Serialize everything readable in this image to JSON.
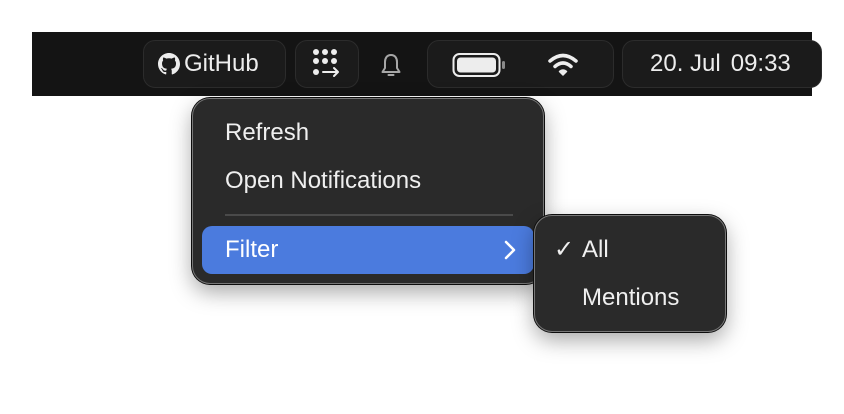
{
  "menubar": {
    "github_label": "GitHub",
    "github_icon": "github-icon",
    "apps_icon": "grid-arrow-icon",
    "bell_icon": "bell-icon",
    "battery_icon": "battery-icon",
    "wifi_icon": "wifi-icon",
    "date": "20. Jul",
    "time": "09:33"
  },
  "menu": {
    "items": [
      {
        "label": "Refresh"
      },
      {
        "label": "Open Notifications"
      },
      {
        "label": "Filter",
        "submenu_icon": "chevron-right-icon",
        "highlighted": true
      }
    ]
  },
  "submenu": {
    "items": [
      {
        "label": "All",
        "checked": true,
        "check": "✓"
      },
      {
        "label": "Mentions",
        "checked": false
      }
    ]
  },
  "colors": {
    "menubar_bg": "#141414",
    "menu_bg": "#2a2a2a",
    "highlight": "#4b7bde"
  }
}
